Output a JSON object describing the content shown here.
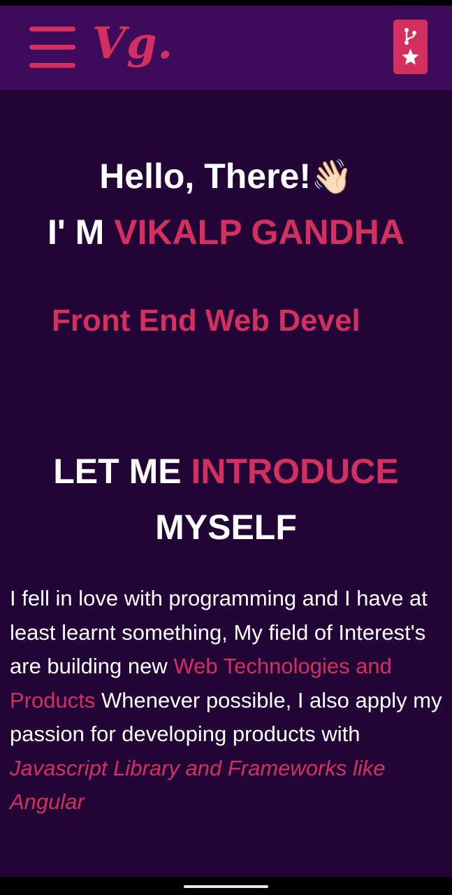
{
  "header": {
    "logo_text": "Vg.",
    "menu_icon": "hamburger-menu-icon",
    "github_icons": [
      "git-fork-icon",
      "star-icon"
    ]
  },
  "hero": {
    "greeting": "Hello, There!",
    "wave_emoji": "👋🏻",
    "iam_prefix": "I' M",
    "name": "VIKALP GANDHA",
    "role_text": "Front End Web Devel"
  },
  "intro": {
    "heading_part1": "LET ME",
    "heading_highlight": "INTRODUCE",
    "heading_part2": "MYSELF",
    "bio_part1": "I fell in love with programming and I have at least learnt something, My field of Interest's are building new",
    "bio_highlight1": "Web Technologies and Products",
    "bio_part2": "Whenever possible, I also apply my passion for developing products with",
    "bio_highlight2": "Javascript Library and Frameworks like Angular"
  },
  "colors": {
    "accent": "#d3305f",
    "navbar_bg": "#3e0b5a",
    "page_bg": "#220536",
    "text": "#ffffff"
  }
}
